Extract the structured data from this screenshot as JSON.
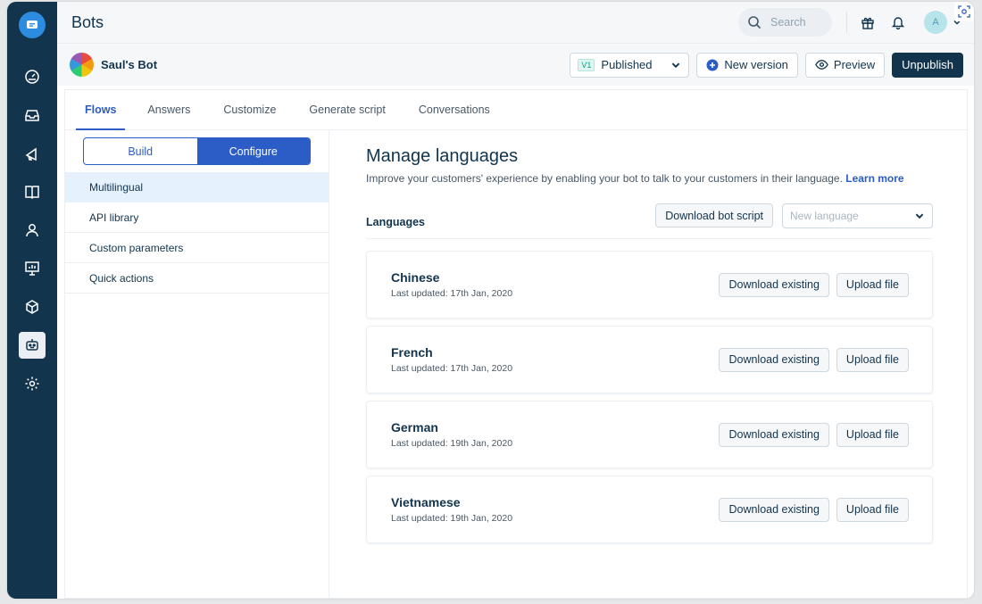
{
  "topbar": {
    "title": "Bots",
    "search_placeholder": "Search",
    "avatar_initial": "A"
  },
  "bot": {
    "name": "Saul's Bot",
    "version_badge": "V1",
    "version_status": "Published",
    "new_version_label": "New version",
    "preview_label": "Preview",
    "unpublish_label": "Unpublish"
  },
  "tabs": [
    {
      "label": "Flows",
      "active": true
    },
    {
      "label": "Answers"
    },
    {
      "label": "Customize"
    },
    {
      "label": "Generate script"
    },
    {
      "label": "Conversations"
    }
  ],
  "segment": {
    "build": "Build",
    "configure": "Configure"
  },
  "left_menu": [
    {
      "label": "Multilingual",
      "active": true
    },
    {
      "label": "API library"
    },
    {
      "label": "Custom parameters"
    },
    {
      "label": "Quick actions"
    }
  ],
  "main": {
    "title": "Manage languages",
    "description": "Improve your customers' experience by enabling your bot to talk to your customers in their language.",
    "learn_more": "Learn more",
    "languages_label": "Languages",
    "download_script_label": "Download bot script",
    "new_language_placeholder": "New language"
  },
  "languages": [
    {
      "name": "Chinese",
      "updated": "Last updated: 17th Jan, 2020"
    },
    {
      "name": "French",
      "updated": "Last updated: 17th Jan, 2020"
    },
    {
      "name": "German",
      "updated": "Last updated: 19th Jan, 2020"
    },
    {
      "name": "Vietnamese",
      "updated": "Last updated: 19th Jan, 2020"
    }
  ],
  "card_actions": {
    "download": "Download existing",
    "upload": "Upload file"
  },
  "colors": {
    "sidebar": "#12344d",
    "accent": "#2c5cc5",
    "primary_dark": "#12344d"
  }
}
